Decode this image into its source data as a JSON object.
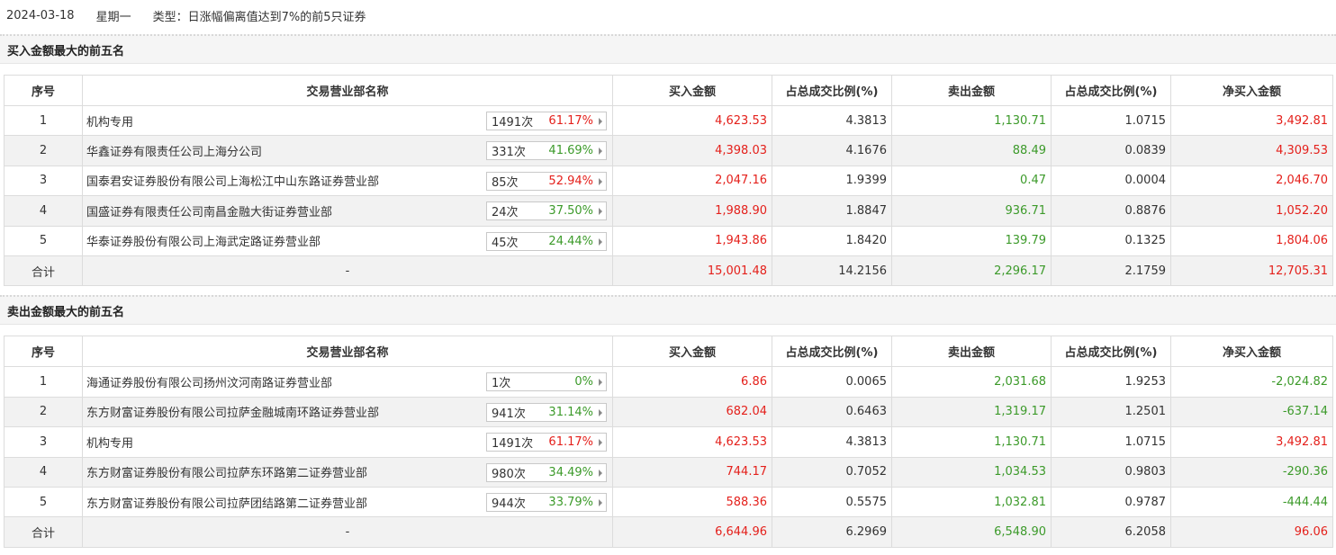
{
  "header": {
    "date": "2024-03-18",
    "weekday": "星期一",
    "type": "类型：日涨幅偏离值达到7%的前5只证券"
  },
  "columns": [
    "序号",
    "交易营业部名称",
    "买入金额",
    "占总成交比例(%)",
    "卖出金额",
    "占总成交比例(%)",
    "净买入金额"
  ],
  "colors": {
    "red": "#e4201b",
    "green": "#3c9a2a"
  },
  "buy_section": {
    "title": "买入金额最大的前五名",
    "rows": [
      {
        "idx": "1",
        "name": "机构专用",
        "count": "1491次",
        "pct": "61.17%",
        "pct_color": "red",
        "buy": "4,623.53",
        "buy_ratio": "4.3813",
        "sell": "1,130.71",
        "sell_ratio": "1.0715",
        "net": "3,492.81",
        "net_color": "red"
      },
      {
        "idx": "2",
        "name": "华鑫证券有限责任公司上海分公司",
        "count": "331次",
        "pct": "41.69%",
        "pct_color": "green",
        "buy": "4,398.03",
        "buy_ratio": "4.1676",
        "sell": "88.49",
        "sell_ratio": "0.0839",
        "net": "4,309.53",
        "net_color": "red"
      },
      {
        "idx": "3",
        "name": "国泰君安证券股份有限公司上海松江中山东路证券营业部",
        "count": "85次",
        "pct": "52.94%",
        "pct_color": "red",
        "buy": "2,047.16",
        "buy_ratio": "1.9399",
        "sell": "0.47",
        "sell_ratio": "0.0004",
        "net": "2,046.70",
        "net_color": "red"
      },
      {
        "idx": "4",
        "name": "国盛证券有限责任公司南昌金融大街证券营业部",
        "count": "24次",
        "pct": "37.50%",
        "pct_color": "green",
        "buy": "1,988.90",
        "buy_ratio": "1.8847",
        "sell": "936.71",
        "sell_ratio": "0.8876",
        "net": "1,052.20",
        "net_color": "red"
      },
      {
        "idx": "5",
        "name": "华泰证券股份有限公司上海武定路证券营业部",
        "count": "45次",
        "pct": "24.44%",
        "pct_color": "green",
        "buy": "1,943.86",
        "buy_ratio": "1.8420",
        "sell": "139.79",
        "sell_ratio": "0.1325",
        "net": "1,804.06",
        "net_color": "red"
      }
    ],
    "total": {
      "label": "合计",
      "name": "-",
      "buy": "15,001.48",
      "buy_ratio": "14.2156",
      "sell": "2,296.17",
      "sell_ratio": "2.1759",
      "net": "12,705.31",
      "net_color": "red"
    }
  },
  "sell_section": {
    "title": "卖出金额最大的前五名",
    "rows": [
      {
        "idx": "1",
        "name": "海通证券股份有限公司扬州汶河南路证券营业部",
        "count": "1次",
        "pct": "0%",
        "pct_color": "green",
        "buy": "6.86",
        "buy_ratio": "0.0065",
        "sell": "2,031.68",
        "sell_ratio": "1.9253",
        "net": "-2,024.82",
        "net_color": "green"
      },
      {
        "idx": "2",
        "name": "东方财富证券股份有限公司拉萨金融城南环路证券营业部",
        "count": "941次",
        "pct": "31.14%",
        "pct_color": "green",
        "buy": "682.04",
        "buy_ratio": "0.6463",
        "sell": "1,319.17",
        "sell_ratio": "1.2501",
        "net": "-637.14",
        "net_color": "green"
      },
      {
        "idx": "3",
        "name": "机构专用",
        "count": "1491次",
        "pct": "61.17%",
        "pct_color": "red",
        "buy": "4,623.53",
        "buy_ratio": "4.3813",
        "sell": "1,130.71",
        "sell_ratio": "1.0715",
        "net": "3,492.81",
        "net_color": "red"
      },
      {
        "idx": "4",
        "name": "东方财富证券股份有限公司拉萨东环路第二证券营业部",
        "count": "980次",
        "pct": "34.49%",
        "pct_color": "green",
        "buy": "744.17",
        "buy_ratio": "0.7052",
        "sell": "1,034.53",
        "sell_ratio": "0.9803",
        "net": "-290.36",
        "net_color": "green"
      },
      {
        "idx": "5",
        "name": "东方财富证券股份有限公司拉萨团结路第二证券营业部",
        "count": "944次",
        "pct": "33.79%",
        "pct_color": "green",
        "buy": "588.36",
        "buy_ratio": "0.5575",
        "sell": "1,032.81",
        "sell_ratio": "0.9787",
        "net": "-444.44",
        "net_color": "green"
      }
    ],
    "total": {
      "label": "合计",
      "name": "-",
      "buy": "6,644.96",
      "buy_ratio": "6.2969",
      "sell": "6,548.90",
      "sell_ratio": "6.2058",
      "net": "96.06",
      "net_color": "red"
    }
  }
}
